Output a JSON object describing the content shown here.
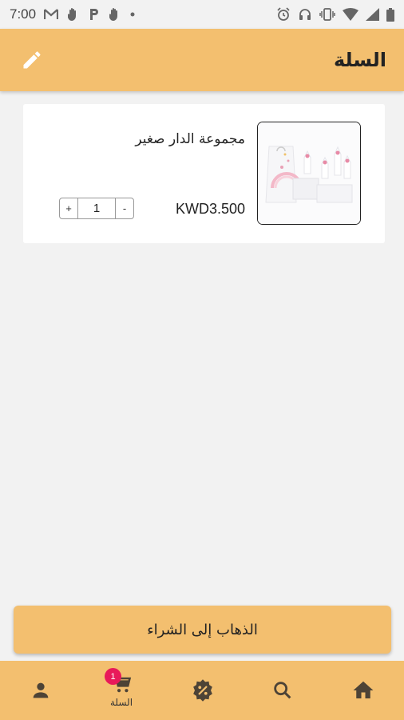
{
  "status_bar": {
    "time": "7:00"
  },
  "app_bar": {
    "title": "السلة"
  },
  "cart": {
    "items": [
      {
        "name": "مجموعة الدار صغير",
        "price": "KWD3.500",
        "quantity": "1",
        "minus_label": "-",
        "plus_label": "+"
      }
    ]
  },
  "checkout": {
    "label": "الذهاب إلى الشراء"
  },
  "bottom_nav": {
    "cart_label": "السلة",
    "cart_badge": "1"
  },
  "colors": {
    "accent": "#f3bf6f",
    "badge": "#e8195a",
    "icon": "#4d4336"
  }
}
